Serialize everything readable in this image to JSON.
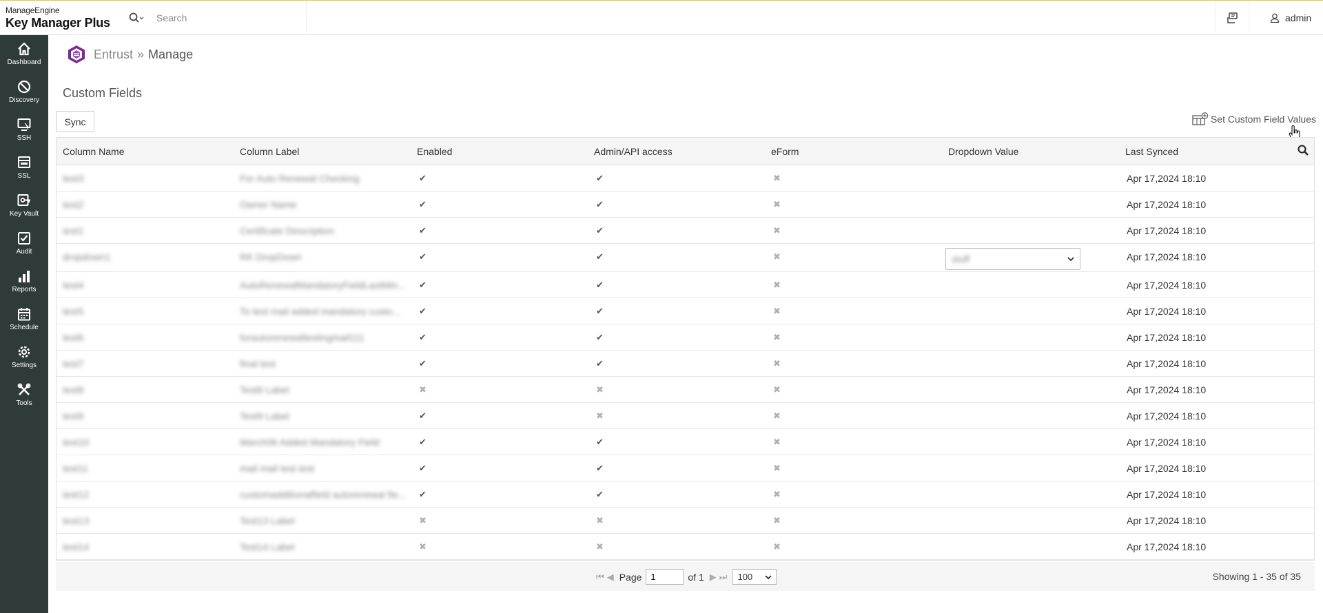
{
  "app": {
    "brand_small": "ManageEngine",
    "brand_big": "Key Manager Plus",
    "search_placeholder": "Search",
    "user": "admin"
  },
  "sidebar": {
    "items": [
      {
        "label": "Dashboard",
        "icon": "home-icon"
      },
      {
        "label": "Discovery",
        "icon": "discovery-icon"
      },
      {
        "label": "SSH",
        "icon": "ssh-icon"
      },
      {
        "label": "SSL",
        "icon": "ssl-icon"
      },
      {
        "label": "Key Vault",
        "icon": "key-vault-icon"
      },
      {
        "label": "Audit",
        "icon": "audit-icon"
      },
      {
        "label": "Reports",
        "icon": "reports-icon"
      },
      {
        "label": "Schedule",
        "icon": "schedule-icon"
      },
      {
        "label": "Settings",
        "icon": "settings-icon"
      },
      {
        "label": "Tools",
        "icon": "tools-icon"
      }
    ]
  },
  "breadcrumb": {
    "parent": "Entrust",
    "separator": "»",
    "current": "Manage"
  },
  "page": {
    "title": "Custom Fields",
    "sync_label": "Sync",
    "set_values_label": "Set Custom Field Values"
  },
  "table": {
    "columns": [
      "Column Name",
      "Column Label",
      "Enabled",
      "Admin/API access",
      "eForm",
      "Dropdown Value",
      "Last Synced"
    ],
    "rows": [
      {
        "name": "test3",
        "label": "For Auto Renewal Checking",
        "enabled": true,
        "admin": true,
        "eform": false,
        "dropdown": "",
        "synced": "Apr 17,2024 18:10"
      },
      {
        "name": "test2",
        "label": "Owner Name",
        "enabled": true,
        "admin": true,
        "eform": false,
        "dropdown": "",
        "synced": "Apr 17,2024 18:10"
      },
      {
        "name": "test1",
        "label": "Certificate Description",
        "enabled": true,
        "admin": true,
        "eform": false,
        "dropdown": "",
        "synced": "Apr 17,2024 18:10"
      },
      {
        "name": "dropdown1",
        "label": "RK DropDown",
        "enabled": true,
        "admin": true,
        "eform": false,
        "dropdown": "stuff",
        "synced": "Apr 17,2024 18:10"
      },
      {
        "name": "test4",
        "label": "AutoRenewalMandatoryFieldLastMin...",
        "enabled": true,
        "admin": true,
        "eform": false,
        "dropdown": "",
        "synced": "Apr 17,2024 18:10"
      },
      {
        "name": "test5",
        "label": "To test mail added mandatory custo...",
        "enabled": true,
        "admin": true,
        "eform": false,
        "dropdown": "",
        "synced": "Apr 17,2024 18:10"
      },
      {
        "name": "test6",
        "label": "forautorenewaltestingmail111",
        "enabled": true,
        "admin": true,
        "eform": false,
        "dropdown": "",
        "synced": "Apr 17,2024 18:10"
      },
      {
        "name": "test7",
        "label": "final test",
        "enabled": true,
        "admin": true,
        "eform": false,
        "dropdown": "",
        "synced": "Apr 17,2024 18:10"
      },
      {
        "name": "test8",
        "label": "Test8 Label",
        "enabled": false,
        "admin": false,
        "eform": false,
        "dropdown": "",
        "synced": "Apr 17,2024 18:10"
      },
      {
        "name": "test9",
        "label": "Test9 Label",
        "enabled": true,
        "admin": false,
        "eform": false,
        "dropdown": "",
        "synced": "Apr 17,2024 18:10"
      },
      {
        "name": "test10",
        "label": "March06 Added Mandatory Field",
        "enabled": true,
        "admin": true,
        "eform": false,
        "dropdown": "",
        "synced": "Apr 17,2024 18:10"
      },
      {
        "name": "test11",
        "label": "mail mail test test",
        "enabled": true,
        "admin": true,
        "eform": false,
        "dropdown": "",
        "synced": "Apr 17,2024 18:10"
      },
      {
        "name": "test12",
        "label": "customadditionalfield autorenewal fie...",
        "enabled": true,
        "admin": true,
        "eform": false,
        "dropdown": "",
        "synced": "Apr 17,2024 18:10"
      },
      {
        "name": "test13",
        "label": "Test13 Label",
        "enabled": false,
        "admin": false,
        "eform": false,
        "dropdown": "",
        "synced": "Apr 17,2024 18:10"
      },
      {
        "name": "test14",
        "label": "Test14 Label",
        "enabled": false,
        "admin": false,
        "eform": false,
        "dropdown": "",
        "synced": "Apr 17,2024 18:10"
      }
    ]
  },
  "pager": {
    "page_label": "Page",
    "page_value": "1",
    "of_label": "of 1",
    "per_page": "100",
    "showing": "Showing 1 - 35 of 35"
  },
  "colors": {
    "sidebar_bg": "#2f3b39",
    "accent_top": "#e8c548",
    "entrust_icon": "#7b2a91"
  }
}
